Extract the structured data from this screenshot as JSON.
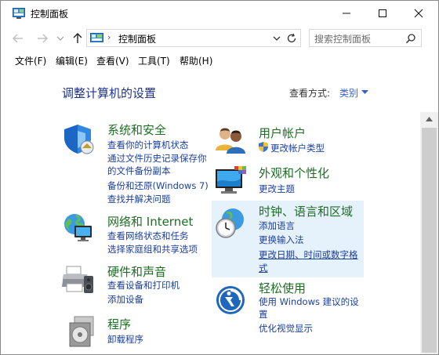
{
  "window": {
    "title": "控制面板",
    "accent": "#1e3287",
    "link_color": "#1a3f9c",
    "category_color": "#1e6e24"
  },
  "address": {
    "separator": "›",
    "path": "控制面板",
    "search_placeholder": "搜索控制面板"
  },
  "menu": {
    "file": "文件(F)",
    "edit": "编辑(E)",
    "view": "查看(V)",
    "tools": "工具(T)",
    "help": "帮助(H)"
  },
  "main": {
    "heading": "调整计算机的设置",
    "view_by_label": "查看方式:",
    "view_by_value": "类别"
  },
  "categories": [
    {
      "title": "系统和安全",
      "icon": "shield-icon",
      "links": [
        "查看你的计算机状态",
        "通过文件历史记录保存你",
        "的文件备份副本",
        "备份和还原(Windows 7)",
        "查找并解决问题"
      ]
    },
    {
      "title": "网络和 Internet",
      "icon": "network-globe-icon",
      "links": [
        "查看网络状态和任务",
        "选择家庭组和共享选项"
      ]
    },
    {
      "title": "硬件和声音",
      "icon": "printer-speaker-icon",
      "links": [
        "查看设备和打印机",
        "添加设备"
      ]
    },
    {
      "title": "程序",
      "icon": "programs-disc-icon",
      "links": [
        "卸载程序"
      ]
    },
    {
      "title": "用户帐户",
      "icon": "users-icon",
      "links": [
        "更改帐户类型"
      ]
    },
    {
      "title": "外观和个性化",
      "icon": "monitor-palette-icon",
      "links": [
        "更改主题"
      ]
    },
    {
      "title": "时钟、语言和区域",
      "icon": "clock-globe-icon",
      "links": [
        "添加语言",
        "更换输入法",
        "更改日期、时间或数字格",
        "式"
      ]
    },
    {
      "title": "轻松使用",
      "icon": "ease-of-access-icon",
      "links": [
        "使用 Windows 建议的设",
        "置",
        "优化视觉显示"
      ]
    }
  ]
}
